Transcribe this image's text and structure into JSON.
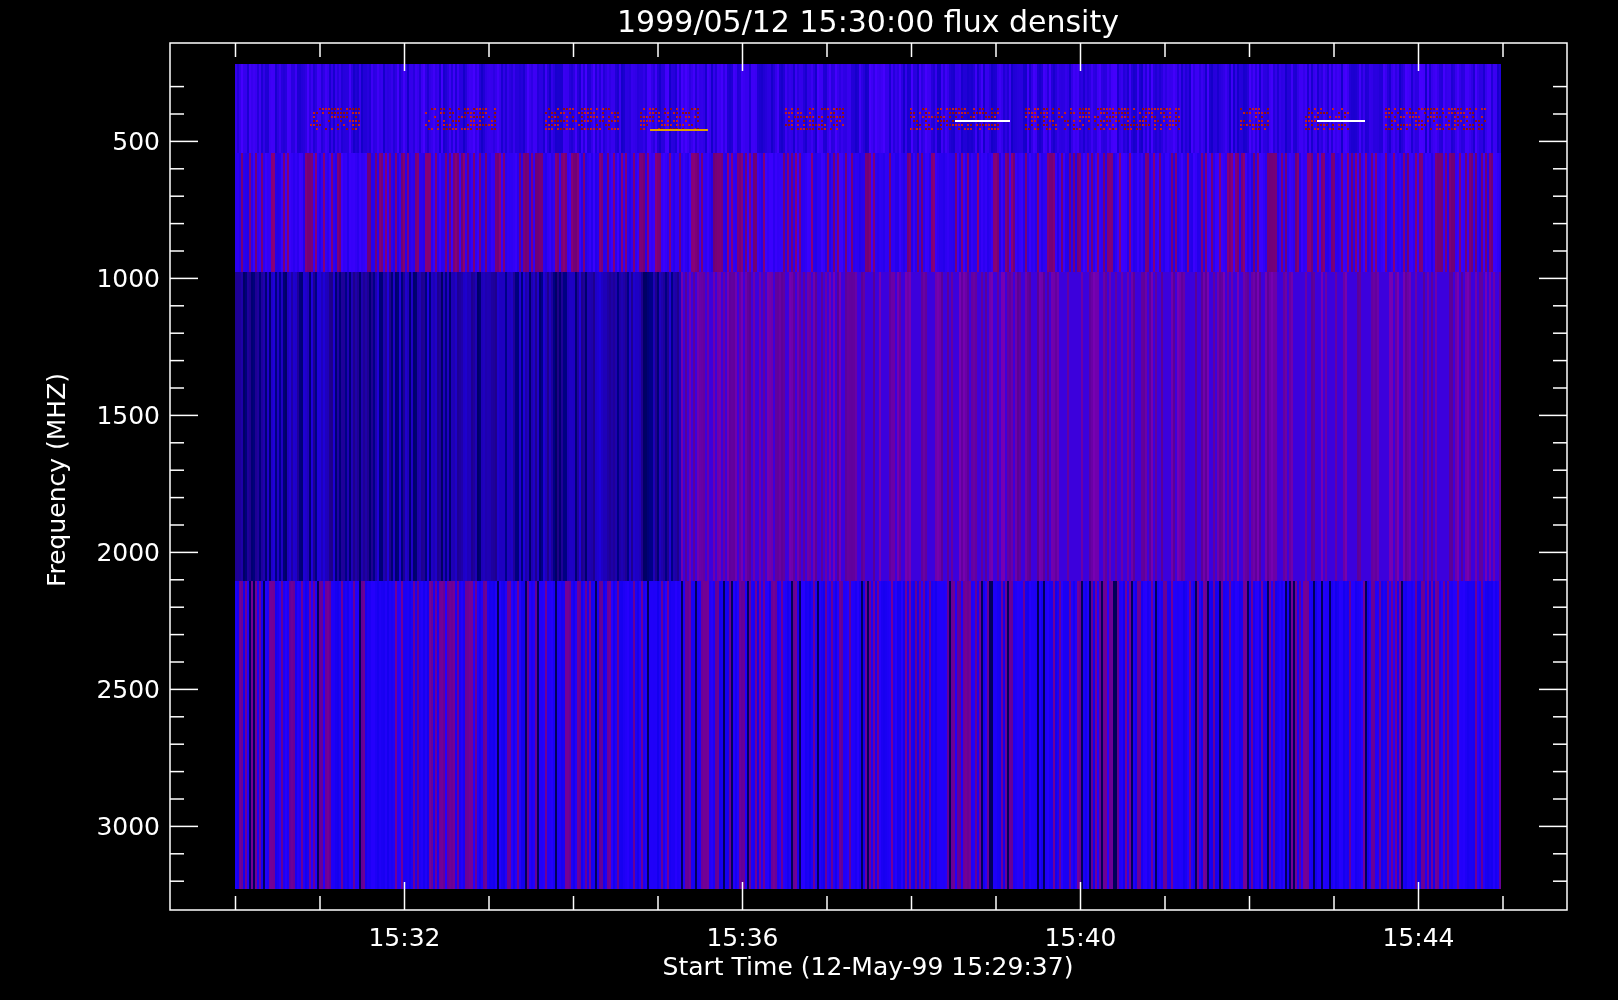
{
  "plot": {
    "title": "1999/05/12 15:30:00 flux density",
    "xlabel": "Start Time (12-May-99 15:29:37)",
    "ylabel": "Frequency (MHZ)",
    "yticks": [
      "500",
      "1000",
      "1500",
      "2000",
      "2500",
      "3000"
    ],
    "xticks": [
      "15:32",
      "15:36",
      "15:40",
      "15:44"
    ]
  }
}
